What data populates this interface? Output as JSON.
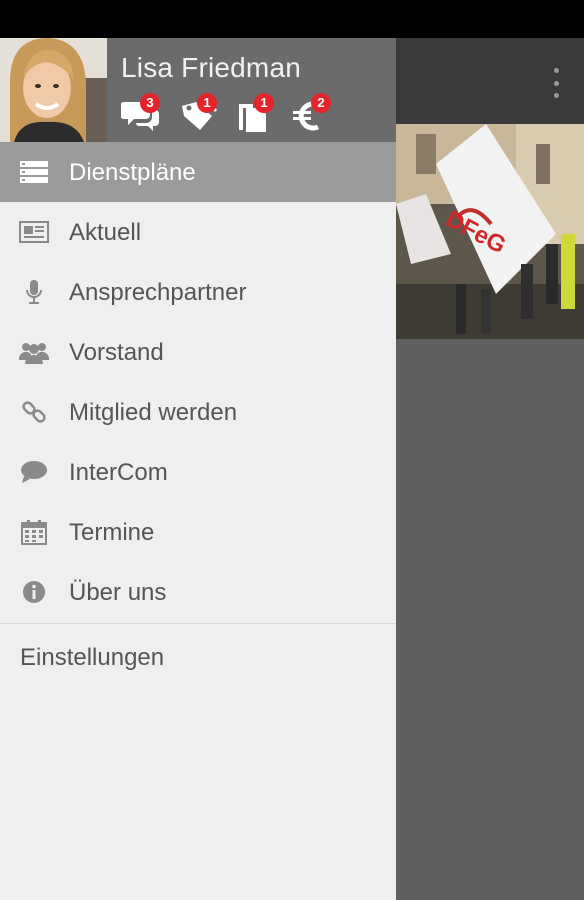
{
  "user": {
    "name": "Lisa Friedman"
  },
  "badges": [
    {
      "icon": "chat-bubbles-icon",
      "count": "3"
    },
    {
      "icon": "tags-icon",
      "count": "1"
    },
    {
      "icon": "documents-icon",
      "count": "1"
    },
    {
      "icon": "euro-icon",
      "count": "2"
    }
  ],
  "menu": [
    {
      "label": "Dienstpläne",
      "icon": "schedule-list-icon",
      "active": true
    },
    {
      "label": "Aktuell",
      "icon": "newspaper-icon"
    },
    {
      "label": "Ansprechpartner",
      "icon": "microphone-icon"
    },
    {
      "label": "Vorstand",
      "icon": "group-icon"
    },
    {
      "label": "Mitglied werden",
      "icon": "link-icon"
    },
    {
      "label": "InterCom",
      "icon": "speech-bubble-icon"
    },
    {
      "label": "Termine",
      "icon": "calendar-icon"
    },
    {
      "label": "Über uns",
      "icon": "info-icon"
    }
  ],
  "settings": {
    "label": "Einstellungen"
  },
  "background": {
    "flag_text": "DFeG"
  },
  "colors": {
    "badge_red": "#e3242b",
    "active_row": "#9b9b9b",
    "header_bg": "#6b6b6b"
  }
}
